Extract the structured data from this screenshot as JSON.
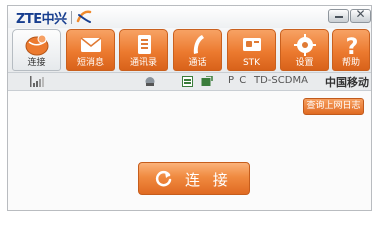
{
  "titlebar": {
    "logo_text": "ZTE中兴",
    "minimize_glyph": "—",
    "close_glyph": "✕"
  },
  "toolbar": {
    "tabs": [
      {
        "label": "连接",
        "icon": "globe-icon",
        "active": true
      },
      {
        "label": "短消息",
        "icon": "envelope-icon"
      },
      {
        "label": "通讯录",
        "icon": "phonebook-icon"
      },
      {
        "label": "通话",
        "icon": "phone-icon"
      },
      {
        "label": "STK",
        "icon": "sim-card-icon"
      },
      {
        "label": "设置",
        "icon": "gear-icon"
      },
      {
        "label": "帮助",
        "icon": "question-icon"
      }
    ]
  },
  "status": {
    "signal_icon": "signal-strength-icon",
    "mode": "P C",
    "network": "TD-SCDMA",
    "operator": "中国移动"
  },
  "main": {
    "log_button_label": "查询上网日志",
    "connect_button_label": "连 接"
  },
  "colors": {
    "accent_orange": "#ec7a2f",
    "brand_blue": "#173e8f"
  }
}
